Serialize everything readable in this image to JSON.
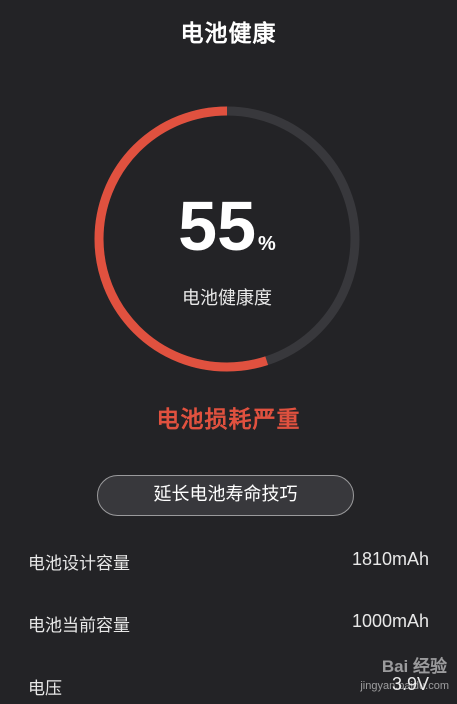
{
  "header": {
    "title": "电池健康"
  },
  "gauge": {
    "percent": 55,
    "value_text": "55",
    "unit": "%",
    "label": "电池健康度",
    "color_active": "#e0513f",
    "color_track": "#38383c"
  },
  "status": {
    "text": "电池损耗严重",
    "color": "#e0513f"
  },
  "tips_button": {
    "label": "延长电池寿命技巧"
  },
  "details": [
    {
      "label": "电池设计容量",
      "value": "1810mAh"
    },
    {
      "label": "电池当前容量",
      "value": "1000mAh"
    },
    {
      "label": "电压",
      "value": "3.9V"
    }
  ],
  "watermark": {
    "logo_text": "Bai 经验",
    "site": "jingyan.baidu.com"
  }
}
